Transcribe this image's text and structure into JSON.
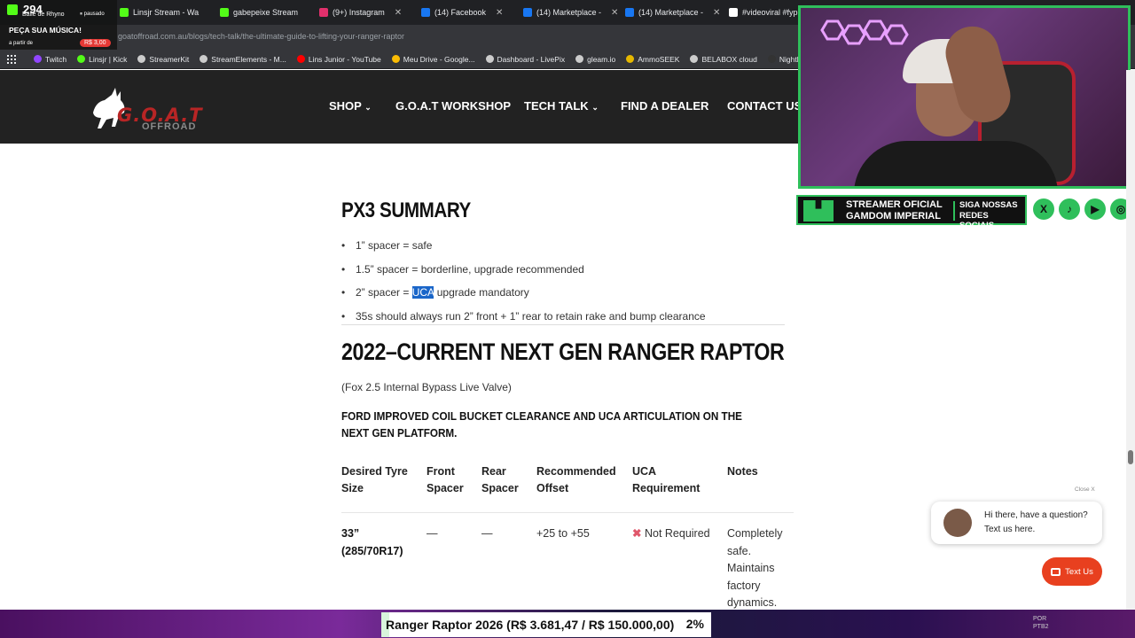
{
  "browser": {
    "tabs": [
      {
        "label": "Linsjr Stream - Wa",
        "color": "#53fc18"
      },
      {
        "label": "gabepeixe Stream",
        "color": "#53fc18"
      },
      {
        "label": "(9+) Instagram",
        "color": "#e1306c"
      },
      {
        "label": "(14) Facebook",
        "color": "#1877f2"
      },
      {
        "label": "(14) Marketplace -",
        "color": "#1877f2"
      },
      {
        "label": "(14) Marketplace -",
        "color": "#1877f2"
      },
      {
        "label": "#videoviral #fyp",
        "color": "#ffffff"
      }
    ],
    "url": "goatoffroad.com.au/blogs/tech-talk/the-ultimate-guide-to-lifting-your-ranger-raptor",
    "bookmarks": [
      {
        "label": "Twitch",
        "color": "#9146ff"
      },
      {
        "label": "Linsjr | Kick",
        "color": "#53fc18"
      },
      {
        "label": "StreamerKit",
        "color": "#cccccc"
      },
      {
        "label": "StreamElements - M...",
        "color": "#cccccc"
      },
      {
        "label": "Lins Junior - YouTube",
        "color": "#ff0000"
      },
      {
        "label": "Meu Drive - Google...",
        "color": "#fbbc04"
      },
      {
        "label": "Dashboard - LivePix",
        "color": "#cccccc"
      },
      {
        "label": "gleam.io",
        "color": "#cccccc"
      },
      {
        "label": "AmmoSEEK",
        "color": "#e6b800"
      },
      {
        "label": "BELABOX cloud",
        "color": "#cccccc"
      },
      {
        "label": "Nightbot - Comm...",
        "color": "#333333"
      }
    ]
  },
  "stream_overlay": {
    "viewer_count": "294",
    "sub_line": "Baile de Rhyno",
    "paused": "⏸ pausado",
    "song_title": "PEÇA SUA MÚSICA!",
    "song_from": "a partir de",
    "song_price": "R$ 3,00"
  },
  "site": {
    "logo_text": "G.O.A.T",
    "logo_sub": "OFFROAD",
    "nav": [
      {
        "label": "SHOP",
        "has_dropdown": true
      },
      {
        "label": "G.O.A.T WORKSHOP",
        "has_dropdown": false
      },
      {
        "label": "TECH TALK",
        "has_dropdown": true
      },
      {
        "label": "FIND A DEALER",
        "has_dropdown": false
      },
      {
        "label": "CONTACT US",
        "has_dropdown": false
      }
    ]
  },
  "article": {
    "px3_heading": "PX3 SUMMARY",
    "bullets": [
      {
        "pre": "1” spacer = safe",
        "hl": "",
        "post": ""
      },
      {
        "pre": "1.5” spacer = borderline, upgrade recommended",
        "hl": "",
        "post": ""
      },
      {
        "pre": "2” spacer = ",
        "hl": "UCA",
        "post": " upgrade mandatory"
      },
      {
        "pre": "35s should always run 2” front + 1” rear to retain rake and bump clearance",
        "hl": "",
        "post": ""
      }
    ],
    "raptor_heading": "2022–CURRENT NEXT GEN RANGER RAPTOR",
    "fox_line": "(Fox 2.5 Internal Bypass Live Valve)",
    "ford_line": "FORD IMPROVED COIL BUCKET CLEARANCE AND UCA ARTICULATION ON THE NEXT GEN PLATFORM.",
    "table": {
      "headers": [
        "Desired Tyre Size",
        "Front Spacer",
        "Rear Spacer",
        "Recommended Offset",
        "UCA Requirement",
        "Notes"
      ],
      "row1": {
        "tyre": "33” (285/70R17)",
        "front": "—",
        "rear": "—",
        "offset": "+25 to +55",
        "uca_mark": "✖",
        "uca": "Not Required",
        "notes": "Completely safe. Maintains factory dynamics."
      }
    }
  },
  "webcam_banner": {
    "line1": "STREAMER OFICIAL",
    "line2": "GAMDOM IMPERIAL",
    "social1": "SIGA NOSSAS",
    "social2": "REDES SOCIAIS",
    "icons": [
      "X",
      "♪",
      "▶",
      "◎"
    ]
  },
  "chat": {
    "close": "Close X",
    "line1": "Hi there, have a question?",
    "line2": "Text us here.",
    "button": "Text Us"
  },
  "goal": {
    "text": "Ranger Raptor 2026 (R$ 3.681,47 / R$ 150.000,00)",
    "percent_label": "2%",
    "progress_fraction": 0.0245
  },
  "tray": {
    "lang1": "POR",
    "lang2": "PTB2"
  }
}
